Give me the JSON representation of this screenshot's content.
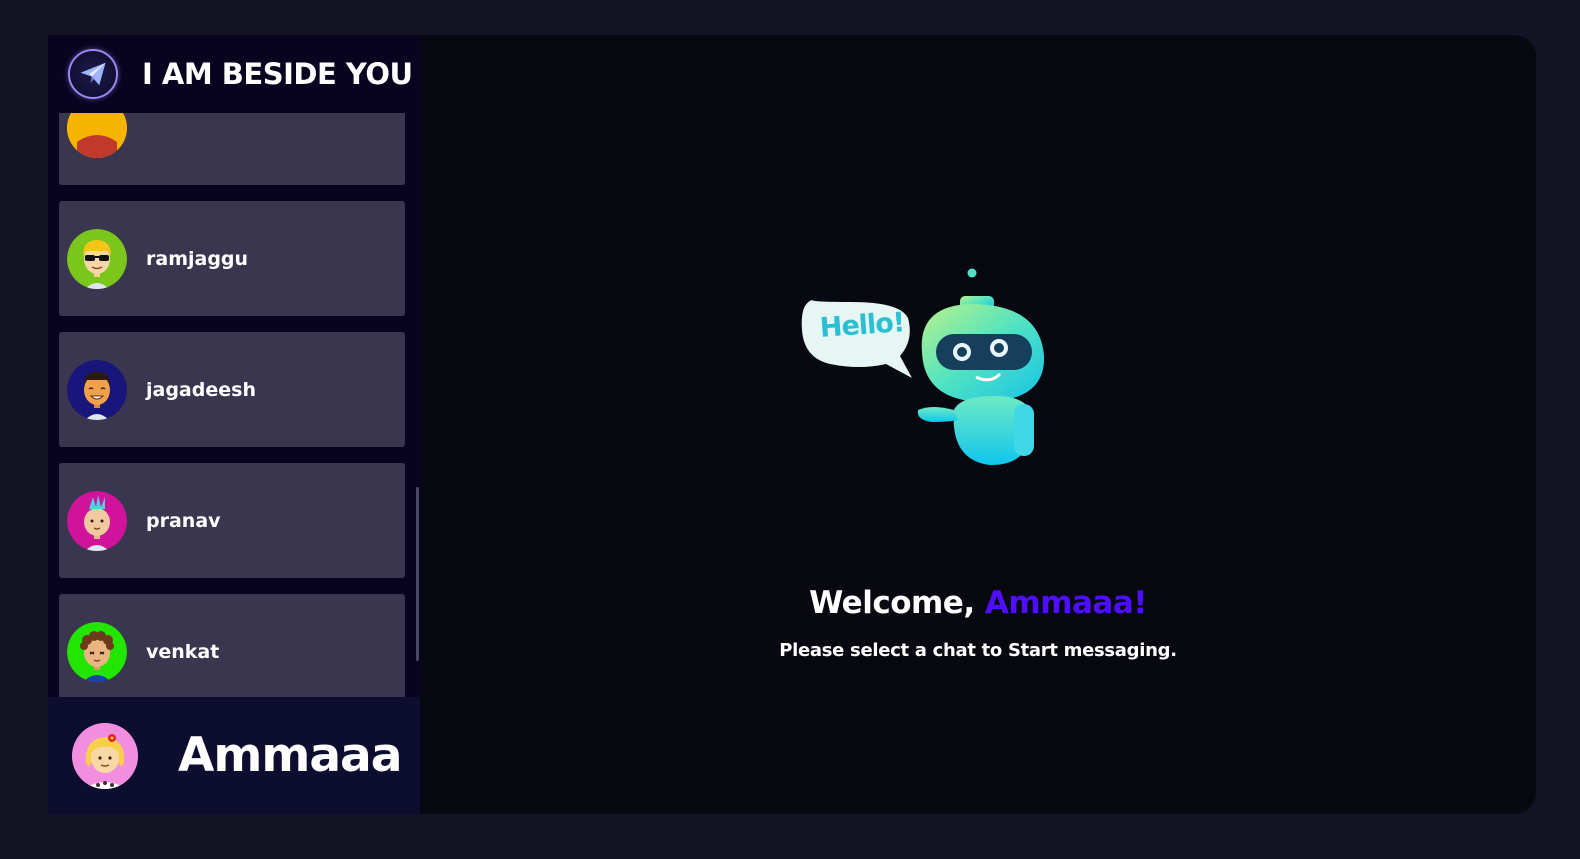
{
  "brand": {
    "title": "I AM BESIDE YOU",
    "logo_icon": "paper-plane-icon"
  },
  "contacts": [
    {
      "name": "",
      "avatar_icon": "avatar-partial-icon",
      "avatar_bg": "#f5b400"
    },
    {
      "name": "ramjaggu",
      "avatar_icon": "avatar-sunglasses-icon",
      "avatar_bg": "#7ac61a"
    },
    {
      "name": "jagadeesh",
      "avatar_icon": "avatar-smiling-boy-icon",
      "avatar_bg": "#18167a"
    },
    {
      "name": "pranav",
      "avatar_icon": "avatar-mohawk-icon",
      "avatar_bg": "#d1129b"
    },
    {
      "name": "venkat",
      "avatar_icon": "avatar-curly-hair-icon",
      "avatar_bg": "#22e600"
    }
  ],
  "current_user": {
    "name": "Ammaaa",
    "avatar_icon": "avatar-girl-flower-icon"
  },
  "welcome": {
    "prefix": "Welcome, ",
    "username": "Ammaaa!",
    "subtitle": "Please select a chat to Start messaging."
  },
  "illustration": {
    "bubble_text": "Hello!",
    "icon": "robot-icon"
  },
  "colors": {
    "accent": "#4e0eff",
    "contact_card": "#3b3650",
    "sidebar_bg": "#080420",
    "main_bg": "#080811"
  }
}
